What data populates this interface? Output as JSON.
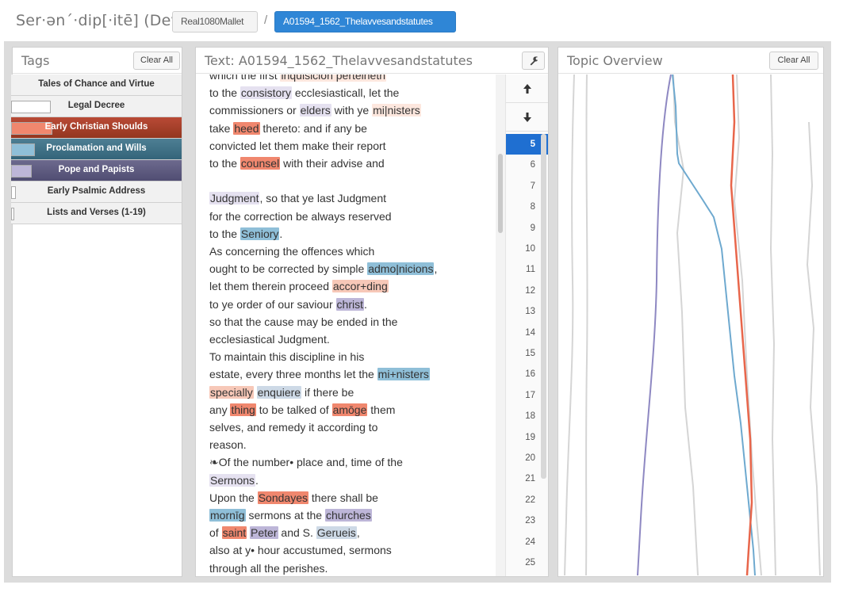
{
  "app": {
    "title": "Ser·ən´·dip[·itē] (Dev)"
  },
  "breadcrumb": {
    "corpus": "Real1080Mallet",
    "separator": "/",
    "document": "A01594_1562_Thelavvesandstatutes"
  },
  "tags_panel": {
    "title": "Tags",
    "clear_label": "Clear All",
    "items": [
      {
        "label": "Tales of Chance and Virtue",
        "state": "off",
        "swatch": "#ffffff"
      },
      {
        "label": "Legal Decree",
        "state": "off",
        "swatch": "#ffffff"
      },
      {
        "label": "Early Christian Shoulds",
        "state": "on",
        "swatch": "#f0876e"
      },
      {
        "label": "Proclamation and Wills",
        "state": "on",
        "swatch": "#8fbfd8"
      },
      {
        "label": "Pope and Papists",
        "state": "on",
        "swatch": "#bdb6d8"
      },
      {
        "label": "Early Psalmic Address",
        "state": "off",
        "swatch": "#ffffff"
      },
      {
        "label": "Lists and Verses (1-19)",
        "state": "off",
        "swatch": "#ffffff"
      }
    ]
  },
  "text_panel": {
    "title": "Text: A01594_1562_Thelavvesandstatutes",
    "wrench_icon": "wrench-icon",
    "lines": [
      [
        {
          "t": "which the first "
        },
        {
          "t": "inquisicion perteineth",
          "c": "c7"
        }
      ],
      [
        {
          "t": "to the "
        },
        {
          "t": "consistory",
          "c": "c6"
        },
        {
          "t": " ecclesiasticall, let the"
        }
      ],
      [
        {
          "t": "commissioners or "
        },
        {
          "t": "elders",
          "c": "c6"
        },
        {
          "t": " with ye "
        },
        {
          "t": "mi|nisters",
          "c": "c7"
        }
      ],
      [
        {
          "t": "take "
        },
        {
          "t": "heed",
          "c": "c1"
        },
        {
          "t": " thereto: and if any be"
        }
      ],
      [
        {
          "t": "convicted let them make their report"
        }
      ],
      [
        {
          "t": "to the "
        },
        {
          "t": "counsel",
          "c": "c1"
        },
        {
          "t": " with their advise and"
        }
      ],
      [
        {
          "t": ""
        }
      ],
      [
        {
          "t": "Judgment",
          "c": "c6"
        },
        {
          "t": ", so that ye last Judgment"
        }
      ],
      [
        {
          "t": "for the correction be always reserved"
        }
      ],
      [
        {
          "t": "to the "
        },
        {
          "t": "Seniory",
          "c": "c3"
        },
        {
          "t": "."
        }
      ],
      [
        {
          "t": "As concerning the offences which"
        }
      ],
      [
        {
          "t": "ought to be corrected by simple "
        },
        {
          "t": "admo|nicions",
          "c": "c3"
        },
        {
          "t": ","
        }
      ],
      [
        {
          "t": "let them therein proceed "
        },
        {
          "t": "accor+ding",
          "c": "c2"
        }
      ],
      [
        {
          "t": "to ye order of our saviour "
        },
        {
          "t": "christ",
          "c": "c5"
        },
        {
          "t": "."
        }
      ],
      [
        {
          "t": "so that the cause may be ended in the"
        }
      ],
      [
        {
          "t": "ecclesiastical Judgment."
        }
      ],
      [
        {
          "t": "To maintain this discipline in his"
        }
      ],
      [
        {
          "t": "estate, every three months let the "
        },
        {
          "t": "mi+nisters",
          "c": "c3"
        }
      ],
      [
        {
          "t": "specially",
          "c": "c2"
        },
        {
          "t": " "
        },
        {
          "t": "enquiere",
          "c": "c4"
        },
        {
          "t": " if there be"
        }
      ],
      [
        {
          "t": "any "
        },
        {
          "t": "thing",
          "c": "c1"
        },
        {
          "t": " to be talked of "
        },
        {
          "t": "amōge",
          "c": "c1"
        },
        {
          "t": " them"
        }
      ],
      [
        {
          "t": "selves, and remedy it according to"
        }
      ],
      [
        {
          "t": "reason."
        }
      ],
      [
        {
          "t": "❧Of the number• place and, time of the"
        }
      ],
      [
        {
          "t": "Sermons",
          "c": "c6"
        },
        {
          "t": "."
        }
      ],
      [
        {
          "t": "Upon the "
        },
        {
          "t": "Sondayes",
          "c": "c1"
        },
        {
          "t": " there shall be"
        }
      ],
      [
        {
          "t": "mornīg",
          "c": "c3"
        },
        {
          "t": " sermons at the "
        },
        {
          "t": "churches",
          "c": "c5"
        }
      ],
      [
        {
          "t": "of "
        },
        {
          "t": "saint",
          "c": "c1"
        },
        {
          "t": " "
        },
        {
          "t": "Peter",
          "c": "c5"
        },
        {
          "t": " and S. "
        },
        {
          "t": "Gerueis",
          "c": "c4"
        },
        {
          "t": ","
        }
      ],
      [
        {
          "t": "also at y• hour accustumed, sermons"
        }
      ],
      [
        {
          "t": "through all the perishes."
        }
      ]
    ],
    "line_numbers": [
      "5",
      "6",
      "7",
      "8",
      "9",
      "10",
      "11",
      "12",
      "13",
      "14",
      "15",
      "16",
      "17",
      "18",
      "19",
      "20",
      "21",
      "22",
      "23",
      "24",
      "25"
    ],
    "current_line": "5",
    "up_icon": "arrow-up-icon",
    "down_icon": "arrow-down-icon"
  },
  "topic_panel": {
    "title": "Topic Overview",
    "clear_label": "Clear All",
    "colors": {
      "orange": "#e8664b",
      "blue": "#6ea9cf",
      "purple": "#8e88c2",
      "grey": "#d5d5d5"
    }
  }
}
